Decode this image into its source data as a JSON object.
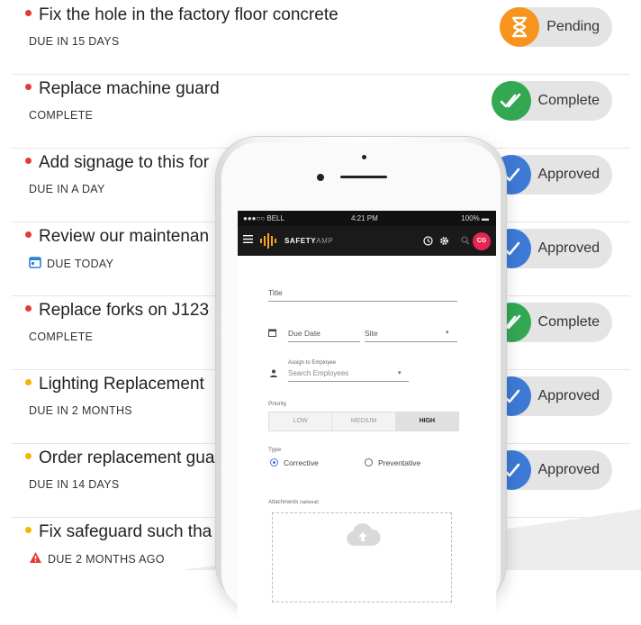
{
  "tasks": [
    {
      "title": "Fix the hole in the factory floor concrete",
      "due": "DUE IN 15 DAYS",
      "due_icon": "",
      "dot_color": "#e53935",
      "status": "Pending",
      "status_icon": "hourglass-icon",
      "status_color": "#f7941d"
    },
    {
      "title": "Replace machine guard",
      "due": "COMPLETE",
      "due_icon": "",
      "dot_color": "#e53935",
      "status": "Complete",
      "status_icon": "double-check-icon",
      "status_color": "#33a853"
    },
    {
      "title": "Add signage to this for",
      "due": "DUE IN A DAY",
      "due_icon": "",
      "dot_color": "#e53935",
      "status": "Approved",
      "status_icon": "check-icon",
      "status_color": "#3d7ad6"
    },
    {
      "title": "Review our maintenan",
      "due": "DUE TODAY",
      "due_icon": "calendar-icon",
      "dot_color": "#e53935",
      "status": "Approved",
      "status_icon": "check-icon",
      "status_color": "#3d7ad6"
    },
    {
      "title": "Replace forks on J123",
      "due": "COMPLETE",
      "due_icon": "",
      "dot_color": "#e53935",
      "status": "Complete",
      "status_icon": "double-check-icon",
      "status_color": "#33a853"
    },
    {
      "title": "Lighting Replacement",
      "due": "DUE IN 2 MONTHS",
      "due_icon": "",
      "dot_color": "#f5b400",
      "status": "Approved",
      "status_icon": "check-icon",
      "status_color": "#3d7ad6"
    },
    {
      "title": "Order replacement gua",
      "due": "DUE IN 14 DAYS",
      "due_icon": "",
      "dot_color": "#f5b400",
      "status": "Approved",
      "status_icon": "check-icon",
      "status_color": "#3d7ad6"
    },
    {
      "title": "Fix safeguard such tha",
      "due": "DUE 2 MONTHS AGO",
      "due_icon": "warning-icon",
      "dot_color": "#f5b400",
      "status": "",
      "status_icon": "",
      "status_color": "#3d7ad6"
    }
  ],
  "phone": {
    "status_bar": {
      "carrier": "●●●○○ BELL",
      "time": "4:21 PM",
      "battery": "100%"
    },
    "app_bar": {
      "brand": "SAFETY",
      "brand_suffix": "AMP",
      "avatar_initials": "CG"
    },
    "form": {
      "title_label": "Title",
      "due_date_label": "Due Date",
      "site_label": "Site",
      "assign_label": "Assign to Employee",
      "assign_placeholder": "Search Employees",
      "priority_label": "Priority",
      "priority_options": [
        "LOW",
        "MEDIUM",
        "HIGH"
      ],
      "priority_selected": "HIGH",
      "type_label": "Type",
      "type_options": [
        "Corrective",
        "Preventative"
      ],
      "type_selected": "Corrective",
      "attachments_label": "Attachments",
      "attachments_hint": "(optional)"
    }
  }
}
